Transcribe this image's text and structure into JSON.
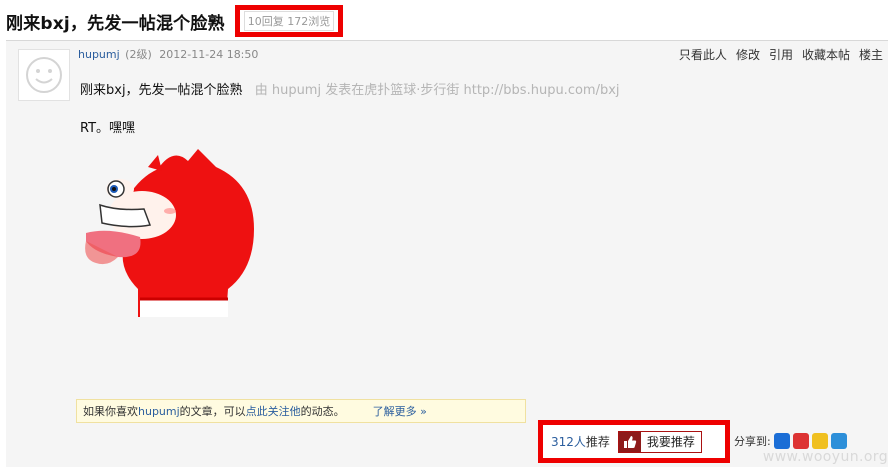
{
  "thread": {
    "title": "刚来bxj，先发一帖混个脸熟",
    "stats": "10回复 172浏览"
  },
  "post": {
    "author": "hupumj",
    "level": "(2级)",
    "time": "2012-11-24 18:50",
    "actions": [
      "只看此人",
      "修改",
      "引用",
      "收藏本帖",
      "楼主"
    ],
    "title": "刚来bxj，先发一帖混个脸熟",
    "via": "由 hupumj 发表在虎扑篮球·步行街 http://bbs.hupu.com/bxj",
    "body": "RT。嘿嘿",
    "image_icon": "red-fox-cartoon-image"
  },
  "follow": {
    "prefix": "如果你喜欢 ",
    "author_link": "hupumj",
    "middle": " 的文章，可以",
    "follow_link": "点此关注他",
    "suffix": "的动态。",
    "learn_more": "了解更多 »"
  },
  "recommend": {
    "count": "312人",
    "count_suffix": "推荐",
    "button_label": "我要推荐",
    "icon": "thumbs-up-icon"
  },
  "share": {
    "label": "分享到:",
    "icons": [
      {
        "name": "share-renren-icon",
        "color": "#1b6ed6"
      },
      {
        "name": "share-weibo-icon",
        "color": "#d33"
      },
      {
        "name": "share-qzone-icon",
        "color": "#f0c020"
      },
      {
        "name": "share-qq-icon",
        "color": "#2d8fd9"
      }
    ]
  },
  "watermark": "www.wooyun.org",
  "colors": {
    "highlight_box": "#ee0000",
    "link": "#2b5e9e",
    "follow_bar_bg": "#fffbe0"
  }
}
